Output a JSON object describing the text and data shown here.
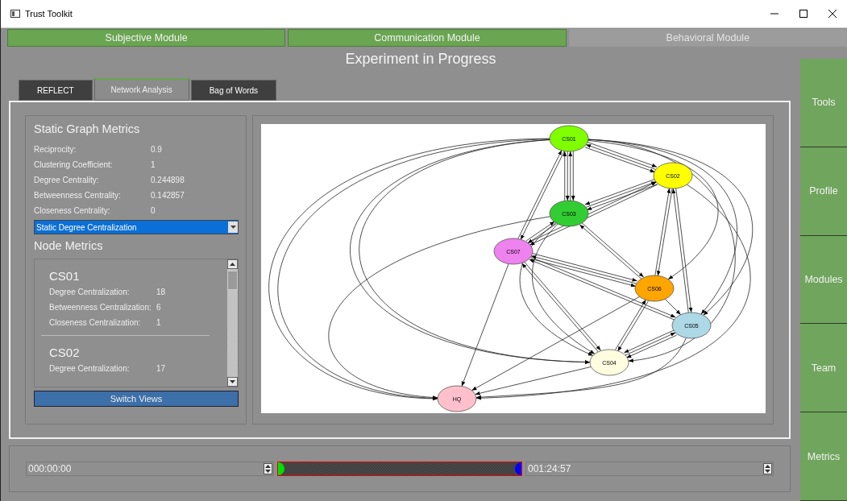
{
  "window": {
    "title": "Trust Toolkit"
  },
  "modules": [
    {
      "label": "Subjective Module",
      "disabled": false
    },
    {
      "label": "Communication Module",
      "disabled": false
    },
    {
      "label": "Behavioral Module",
      "disabled": true
    }
  ],
  "heading": "Experiment in Progress",
  "tabs": [
    {
      "label": "REFLECT",
      "selected": false
    },
    {
      "label": "Network Analysis",
      "selected": true
    },
    {
      "label": "Bag of Words",
      "selected": false
    }
  ],
  "static_metrics": {
    "title": "Static Graph Metrics",
    "rows": [
      {
        "label": "Reciprocity:",
        "value": "0.9"
      },
      {
        "label": "Clustering Coefficient:",
        "value": "1"
      },
      {
        "label": "Degree Centrality:",
        "value": "0.244898"
      },
      {
        "label": "Betweenness Centrality:",
        "value": "0.142857"
      },
      {
        "label": "Closeness Centrality:",
        "value": "0"
      }
    ]
  },
  "dropdown": {
    "value": "Static Degree Centralization"
  },
  "node_metrics": {
    "title": "Node Metrics",
    "nodes": [
      {
        "name": "CS01",
        "rows": [
          {
            "label": "Degree Centralization:",
            "value": "18"
          },
          {
            "label": "Betweenness Centralization:",
            "value": "6"
          },
          {
            "label": "Closeness Centralization:",
            "value": "1"
          }
        ]
      },
      {
        "name": "CS02",
        "rows": [
          {
            "label": "Degree Centralization:",
            "value": "17"
          }
        ]
      }
    ]
  },
  "switch_button": "Switch Views",
  "graph": {
    "nodes": [
      {
        "label": "CS01",
        "color": "#7fff00"
      },
      {
        "label": "CS02",
        "color": "#ffff00"
      },
      {
        "label": "CS03",
        "color": "#32cd32"
      },
      {
        "label": "CS07",
        "color": "#ee82ee"
      },
      {
        "label": "CS06",
        "color": "#ffa500"
      },
      {
        "label": "CS05",
        "color": "#add8e6"
      },
      {
        "label": "CS04",
        "color": "#fffde0"
      },
      {
        "label": "HQ",
        "color": "#ffc0cb"
      }
    ]
  },
  "timeline": {
    "start": "000:00:00",
    "end": "001:24:57",
    "handles": [
      {
        "level": 0
      },
      {
        "level": 1
      }
    ]
  },
  "side_buttons": [
    "Tools",
    "Profile",
    "Modules",
    "Team",
    "Metrics"
  ]
}
